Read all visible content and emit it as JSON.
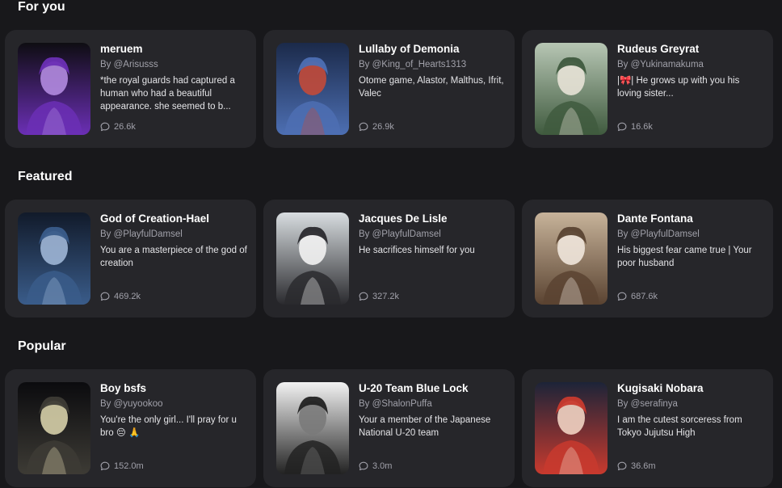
{
  "sections": [
    {
      "title": "For you",
      "cards": [
        {
          "name": "meruem",
          "author": "By @Arisusss",
          "description": "*the royal guards had captured a human who had a beautiful appearance. she seemed to b...",
          "chats": "26.6k",
          "avatar_colors": [
            "#0e0d12",
            "#6b2fb5",
            "#b38be0"
          ]
        },
        {
          "name": "Lullaby of Demonia",
          "author": "By @King_of_Hearts1313",
          "description": "Otome game, Alastor, Malthus, Ifrit, Valec",
          "chats": "26.9k",
          "avatar_colors": [
            "#1b2a4a",
            "#4d6fb3",
            "#c24a3a"
          ]
        },
        {
          "name": "Rudeus Greyrat",
          "author": "By @Yukinamakuma",
          "description": "|🎀| He grows up with you his loving sister...",
          "chats": "16.6k",
          "avatar_colors": [
            "#b7c6b4",
            "#3f5a3e",
            "#e7e2d6"
          ]
        }
      ]
    },
    {
      "title": "Featured",
      "cards": [
        {
          "name": "God of Creation-Hael",
          "author": "By @PlayfulDamsel",
          "description": "You are a masterpiece of the god of creation",
          "chats": "469.2k",
          "avatar_colors": [
            "#111a2a",
            "#3a5c8a",
            "#9fb6d6"
          ]
        },
        {
          "name": "Jacques De Lisle",
          "author": "By @PlayfulDamsel",
          "description": "He sacrifices himself for you",
          "chats": "327.2k",
          "avatar_colors": [
            "#d8dde0",
            "#2a2a2e",
            "#f2f2f2"
          ]
        },
        {
          "name": "Dante Fontana",
          "author": "By @PlayfulDamsel",
          "description": "His biggest fear came true | Your poor husband",
          "chats": "687.6k",
          "avatar_colors": [
            "#c7b39a",
            "#5a4331",
            "#efe6dc"
          ]
        }
      ]
    },
    {
      "title": "Popular",
      "cards": [
        {
          "name": "Boy bsfs",
          "author": "By @yuyookoo",
          "description": "You're the only girl... I'll pray for u bro 😔 🙏",
          "chats": "152.0m",
          "avatar_colors": [
            "#0b0b0e",
            "#3d3b35",
            "#d6cfa8"
          ]
        },
        {
          "name": "U-20 Team Blue Lock",
          "author": "By @ShalonPuffa",
          "description": "Your a member of the Japanese National U-20 team",
          "chats": "3.0m",
          "avatar_colors": [
            "#f3f3f3",
            "#222222",
            "#7a7a7a"
          ]
        },
        {
          "name": "Kugisaki Nobara",
          "author": "By @serafinya",
          "description": "I am the cutest sorceress from Tokyo Jujutsu High",
          "chats": "36.6m",
          "avatar_colors": [
            "#1c2438",
            "#c83a2e",
            "#f1d3c2"
          ]
        }
      ]
    }
  ]
}
